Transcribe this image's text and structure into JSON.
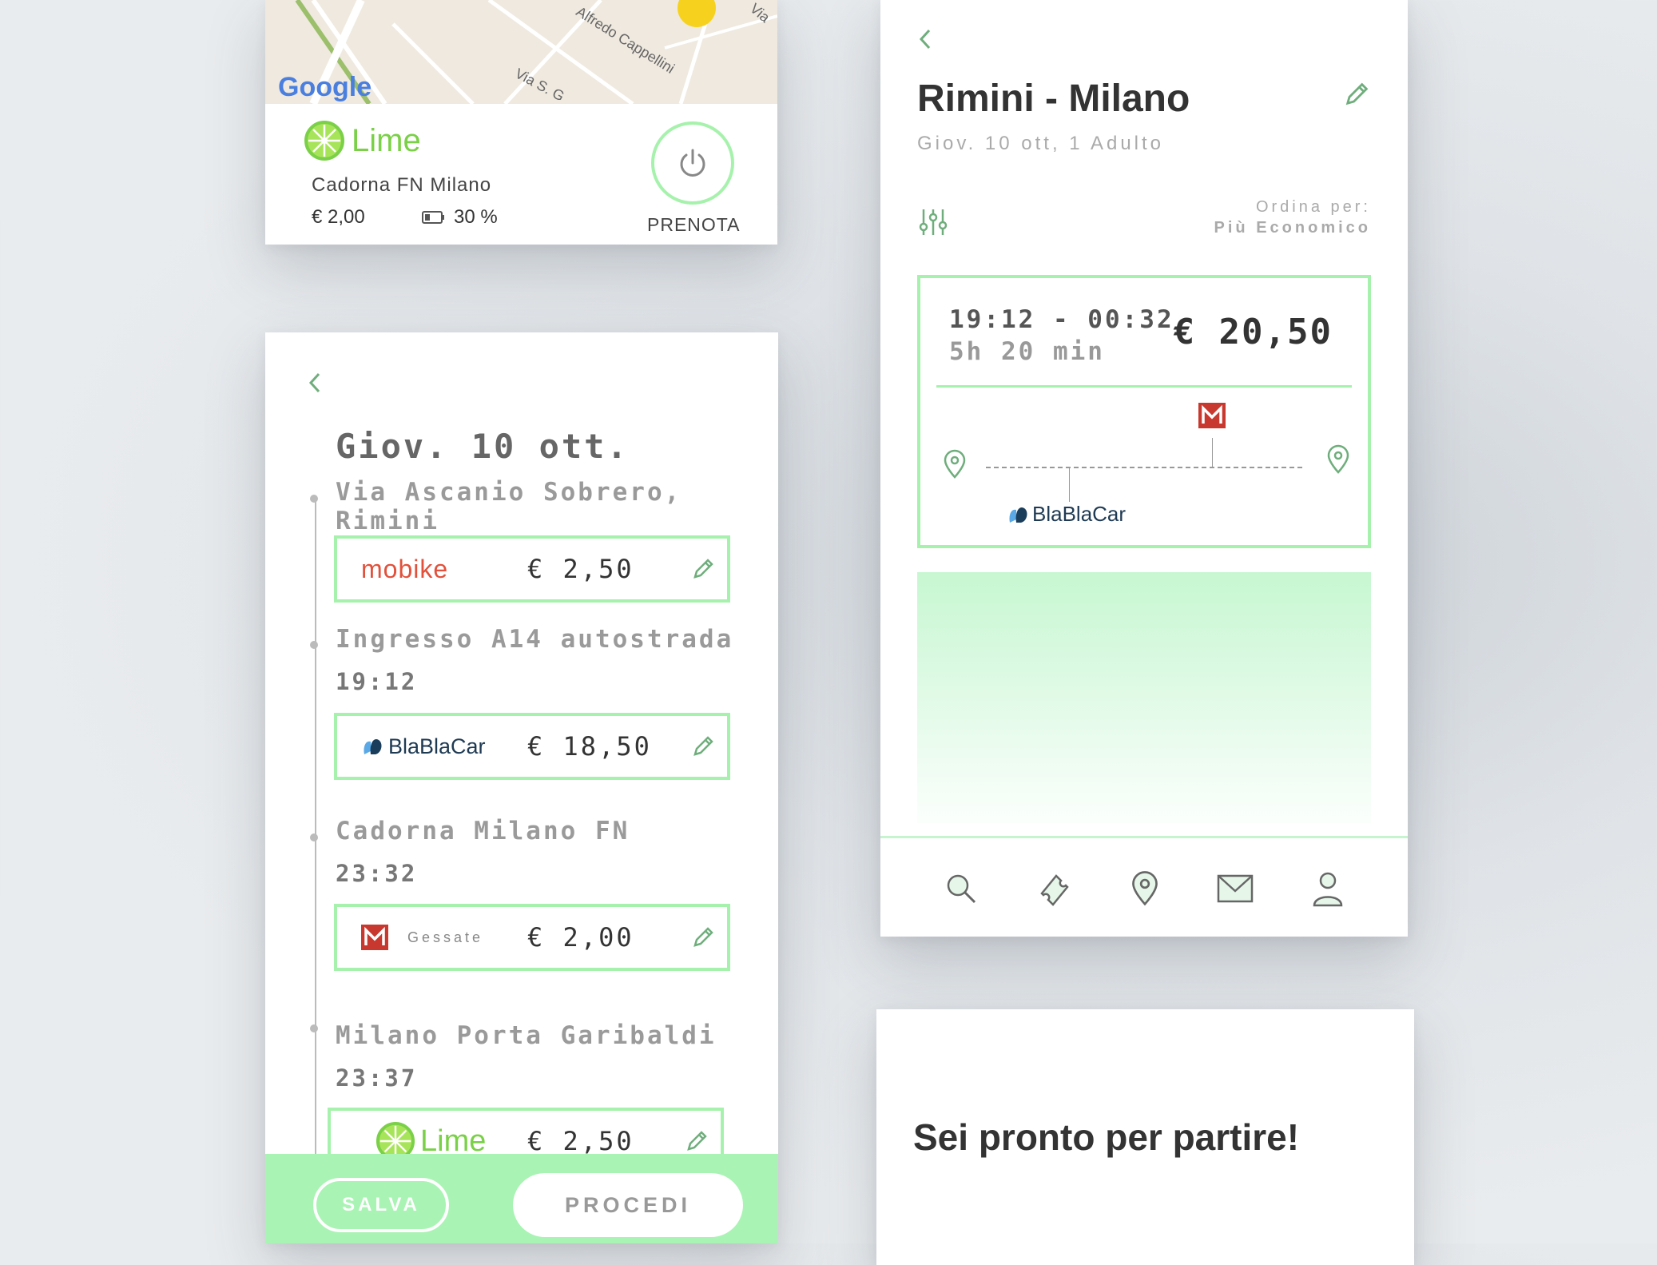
{
  "map": {
    "brand": "Google",
    "streets": [
      "Alfredo Cappellini",
      "Via S. G",
      "Via"
    ]
  },
  "lime_card": {
    "brand": "Lime",
    "station": "Cadorna FN Milano",
    "price": "€ 2,00",
    "battery": "30 %",
    "book_label": "PRENOTA"
  },
  "journey": {
    "back_icon": "chevron-left-icon",
    "date": "Giov. 10 ott.",
    "stops": [
      {
        "name": "Via Ascanio Sobrero, Rimini",
        "time": ""
      },
      {
        "name": "Ingresso A14 autostrada",
        "time": "19:12"
      },
      {
        "name": "Cadorna Milano FN",
        "time": "23:32"
      },
      {
        "name": "Milano Porta Garibaldi",
        "time": "23:37"
      }
    ],
    "segments": [
      {
        "provider": "mobike",
        "extra": "",
        "price": "€ 2,50"
      },
      {
        "provider": "BlaBlaCar",
        "extra": "",
        "price": "€ 18,50"
      },
      {
        "provider": "metro-m",
        "extra": "Gessate",
        "price": "€ 2,00"
      },
      {
        "provider": "Lime",
        "extra": "",
        "price": "€ 2,50"
      }
    ],
    "save_label": "SALVA",
    "proceed_label": "PROCEDI",
    "colors": {
      "accent": "#a6f2ac",
      "bar": "#a9f3b4"
    }
  },
  "results": {
    "title": "Rimini - Milano",
    "subtitle": "Giov. 10 ott, 1 Adulto",
    "order_label": "Ordina per:",
    "order_value": "Più Economico",
    "card": {
      "times": "19:12 - 00:32",
      "duration": "5h 20 min",
      "price": "€ 20,50",
      "provider_1": "BlaBlaCar",
      "provider_2_icon": "metro-m-icon"
    },
    "tabs": [
      "search-icon",
      "ticket-icon",
      "location-pin-icon",
      "mail-icon",
      "user-icon"
    ]
  },
  "ready": {
    "text": "Sei pronto per partire!"
  }
}
